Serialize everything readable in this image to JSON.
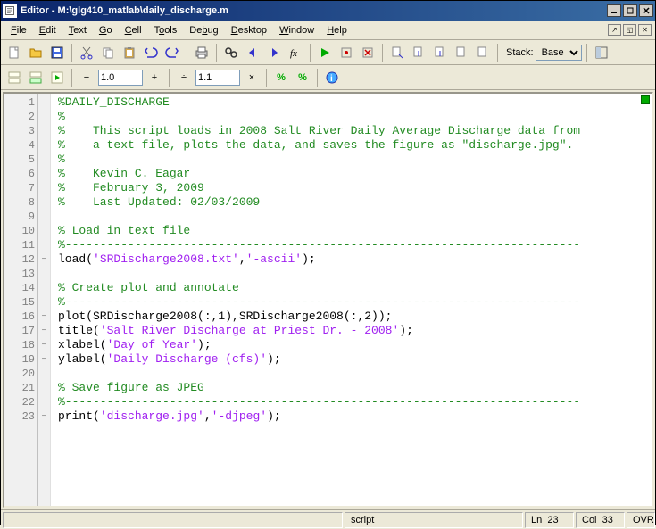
{
  "window": {
    "title": "Editor - M:\\glg410_matlab\\daily_discharge.m"
  },
  "menu": {
    "file": "File",
    "edit": "Edit",
    "text": "Text",
    "go": "Go",
    "cell": "Cell",
    "tools": "Tools",
    "debug": "Debug",
    "desktop": "Desktop",
    "window": "Window",
    "help": "Help"
  },
  "toolbar": {
    "stack_label": "Stack:",
    "stack_value": "Base"
  },
  "toolbar2": {
    "zoom1": "1.0",
    "zoom2": "1.1"
  },
  "code": {
    "total_lines": 23,
    "bp_markers": [
      12,
      16,
      17,
      18,
      19,
      23
    ],
    "lines": [
      {
        "n": 1,
        "tokens": [
          {
            "t": "%DAILY_DISCHARGE",
            "c": "c-com"
          }
        ]
      },
      {
        "n": 2,
        "tokens": [
          {
            "t": "%",
            "c": "c-com"
          }
        ]
      },
      {
        "n": 3,
        "tokens": [
          {
            "t": "%    This script loads in 2008 Salt River Daily Average Discharge data from",
            "c": "c-com"
          }
        ]
      },
      {
        "n": 4,
        "tokens": [
          {
            "t": "%    a text file, plots the data, and saves the figure as \"discharge.jpg\".",
            "c": "c-com"
          }
        ]
      },
      {
        "n": 5,
        "tokens": [
          {
            "t": "%",
            "c": "c-com"
          }
        ]
      },
      {
        "n": 6,
        "tokens": [
          {
            "t": "%    Kevin C. Eagar",
            "c": "c-com"
          }
        ]
      },
      {
        "n": 7,
        "tokens": [
          {
            "t": "%    February 3, 2009",
            "c": "c-com"
          }
        ]
      },
      {
        "n": 8,
        "tokens": [
          {
            "t": "%    Last Updated: 02/03/2009",
            "c": "c-com"
          }
        ]
      },
      {
        "n": 9,
        "tokens": []
      },
      {
        "n": 10,
        "tokens": [
          {
            "t": "% Load in text file",
            "c": "c-com"
          }
        ]
      },
      {
        "n": 11,
        "tokens": [
          {
            "t": "%--------------------------------------------------------------------------",
            "c": "c-com"
          }
        ]
      },
      {
        "n": 12,
        "tokens": [
          {
            "t": "load(",
            "c": ""
          },
          {
            "t": "'SRDischarge2008.txt'",
            "c": "c-str"
          },
          {
            "t": ",",
            "c": ""
          },
          {
            "t": "'-ascii'",
            "c": "c-str"
          },
          {
            "t": ");",
            "c": ""
          }
        ]
      },
      {
        "n": 13,
        "tokens": []
      },
      {
        "n": 14,
        "tokens": [
          {
            "t": "% Create plot and annotate",
            "c": "c-com"
          }
        ]
      },
      {
        "n": 15,
        "tokens": [
          {
            "t": "%--------------------------------------------------------------------------",
            "c": "c-com"
          }
        ]
      },
      {
        "n": 16,
        "tokens": [
          {
            "t": "plot(SRDischarge2008(:,1),SRDischarge2008(:,2));",
            "c": ""
          }
        ]
      },
      {
        "n": 17,
        "tokens": [
          {
            "t": "title(",
            "c": ""
          },
          {
            "t": "'Salt River Discharge at Priest Dr. - 2008'",
            "c": "c-str"
          },
          {
            "t": ");",
            "c": ""
          }
        ]
      },
      {
        "n": 18,
        "tokens": [
          {
            "t": "xlabel(",
            "c": ""
          },
          {
            "t": "'Day of Year'",
            "c": "c-str"
          },
          {
            "t": ");",
            "c": ""
          }
        ]
      },
      {
        "n": 19,
        "tokens": [
          {
            "t": "ylabel(",
            "c": ""
          },
          {
            "t": "'Daily Discharge (cfs)'",
            "c": "c-str"
          },
          {
            "t": ");",
            "c": ""
          }
        ]
      },
      {
        "n": 20,
        "tokens": []
      },
      {
        "n": 21,
        "tokens": [
          {
            "t": "% Save figure as JPEG",
            "c": "c-com"
          }
        ]
      },
      {
        "n": 22,
        "tokens": [
          {
            "t": "%--------------------------------------------------------------------------",
            "c": "c-com"
          }
        ]
      },
      {
        "n": 23,
        "tokens": [
          {
            "t": "print(",
            "c": ""
          },
          {
            "t": "'discharge.jpg'",
            "c": "c-str"
          },
          {
            "t": ",",
            "c": ""
          },
          {
            "t": "'-djpeg'",
            "c": "c-str"
          },
          {
            "t": ");",
            "c": ""
          }
        ]
      }
    ]
  },
  "status": {
    "type": "script",
    "ln_label": "Ln",
    "ln": "23",
    "col_label": "Col",
    "col": "33",
    "ovr": "OVR"
  }
}
